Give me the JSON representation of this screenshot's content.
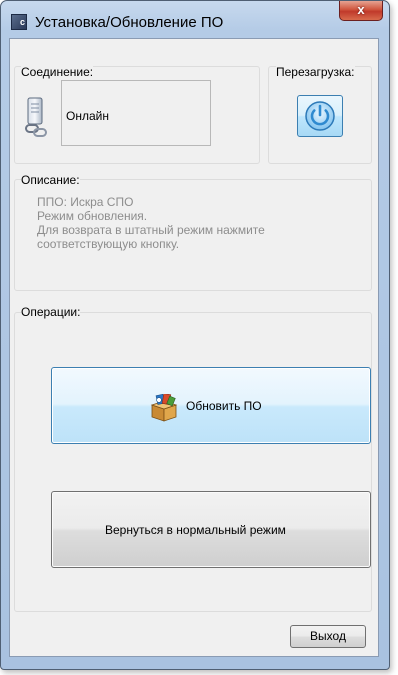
{
  "window": {
    "title": "Установка/Обновление ПО",
    "app_icon_letter": "c",
    "close_glyph": "x"
  },
  "connection": {
    "label": "Соединение:",
    "status": "Онлайн",
    "icon": "connection-link-icon"
  },
  "reboot": {
    "label": "Перезагрузка:",
    "icon": "power-icon"
  },
  "description": {
    "label": "Описание:",
    "lines": [
      "ППО: Искра СПО",
      "Режим обновления.",
      "Для возврата в штатный режим нажмите",
      "соответствующую кнопку."
    ]
  },
  "operations": {
    "label": "Операции:",
    "update_label": "Обновить ПО",
    "update_icon": "package-box-icon",
    "normal_label": "Вернуться в нормальный режим"
  },
  "footer": {
    "exit_label": "Выход"
  },
  "colors": {
    "accent": "#3c7fb1",
    "status_description": "#8d8d8d",
    "close_button": "#c0392b"
  }
}
